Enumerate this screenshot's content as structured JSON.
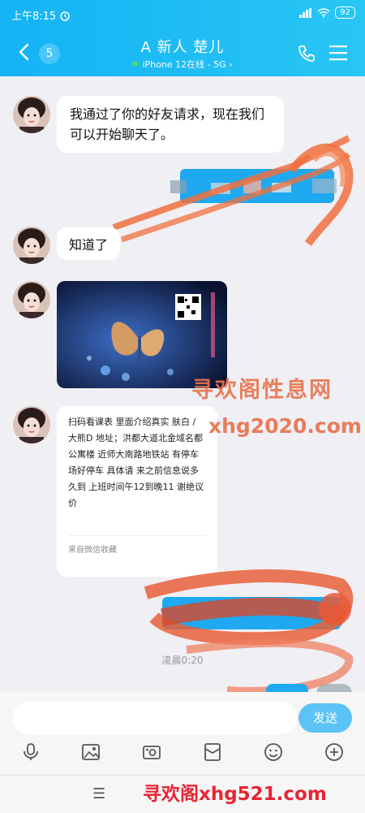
{
  "status_bar": {
    "time": "上午8:15",
    "battery": "92"
  },
  "header": {
    "unread_count": "5",
    "contact_name": "A 新人 楚儿",
    "presence": "iPhone 12在线 - 5G",
    "presence_chevron": "›"
  },
  "messages": {
    "m1": "我通过了你的好友请求，现在我们可以开始聊天了。",
    "m2": "知道了",
    "card": {
      "body": "扫码看课表 里面介绍真实  肤白 / 大熊D 地址；洪都大道北金域名都公寓楼  近师大南路地铁站 有停车场好停车  具体请 来之前信息说多久到  上班时间午12到晚11  谢绝议价",
      "source": "来自微信收藏"
    },
    "timestamp": "凌晨0:20"
  },
  "watermarks": {
    "w1": "寻欢阁性息网",
    "w2": "xhg2020.com",
    "w3": "寻欢阁xhg521.com"
  },
  "input": {
    "placeholder": "",
    "send_label": "发送"
  },
  "icons": {
    "back": "chevron-left-icon",
    "phone": "phone-icon",
    "menu": "menu-icon",
    "mic": "microphone-icon",
    "image": "image-icon",
    "camera": "camera-icon",
    "red_packet": "red-packet-icon",
    "emoji": "emoji-icon",
    "more": "plus-circle-icon"
  },
  "colors": {
    "header": "#1fbdf5",
    "send": "#5cc3f6",
    "watermark": "#e8734d"
  }
}
